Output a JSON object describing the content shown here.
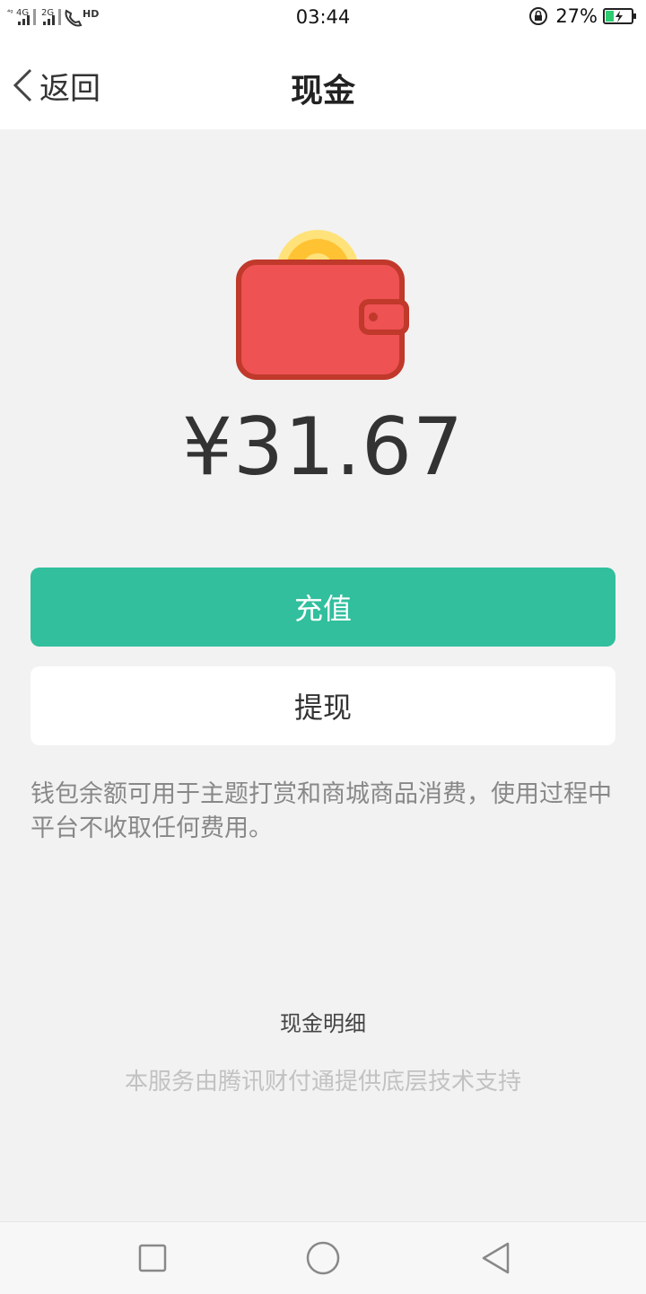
{
  "status_bar": {
    "network_1": "4G",
    "network_2": "2G",
    "call_icon_label": "HD",
    "time": "03:44",
    "battery_percent": "27%"
  },
  "nav": {
    "back_label": "返回",
    "title": "现金"
  },
  "wallet": {
    "balance": "¥31.67"
  },
  "actions": {
    "recharge_label": "充值",
    "withdraw_label": "提现"
  },
  "notice": "钱包余额可用于主题打赏和商城商品消费，使用过程中平台不收取任何费用。",
  "details_link": "现金明细",
  "footer_note": "本服务由腾讯财付通提供底层技术支持",
  "colors": {
    "accent": "#31bf9d",
    "wallet_red": "#ee5253",
    "coin_gold": "#ffc233"
  },
  "icons": {
    "back": "chevron-left-icon",
    "wallet": "wallet-coin-icon",
    "recent": "square-icon",
    "home": "circle-icon",
    "back_nav": "triangle-left-icon"
  }
}
